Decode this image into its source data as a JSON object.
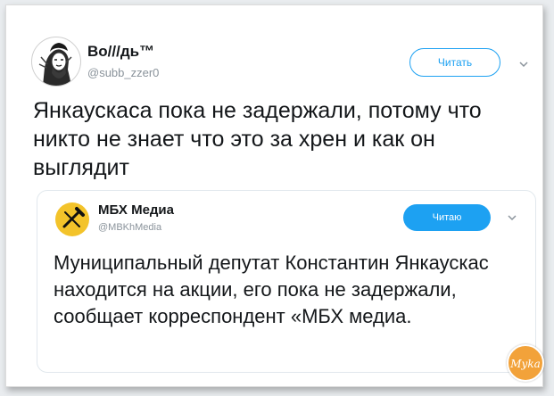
{
  "tweet": {
    "author_name": "Во///дь™",
    "author_handle": "@subb_zzer0",
    "follow_label": "Читать",
    "text": "Янкаускаса пока не задержали, потому что никто не знает что это за хрен и как он выглядит",
    "avatar_icon": "portrait-sketch-icon",
    "menu_icon": "chevron-down-icon"
  },
  "quoted_tweet": {
    "author_name": "МБХ Медиа",
    "author_handle": "@MBKhMedia",
    "follow_label": "Читаю",
    "text": "Муниципальный депутат Константин Янкаускас находится на акции, его пока не задержали, сообщает корреспондент «МБХ медиа.",
    "avatar_icon": "mbh-logo-icon",
    "menu_icon": "chevron-down-icon"
  },
  "watermark": {
    "text": "Myka",
    "icon": "watermark-logo-icon"
  },
  "colors": {
    "accent": "#1da1f2",
    "text": "#14171a",
    "secondary": "#8a939b",
    "quote_avatar": "#f3c32a",
    "watermark": "#f2a23a"
  }
}
